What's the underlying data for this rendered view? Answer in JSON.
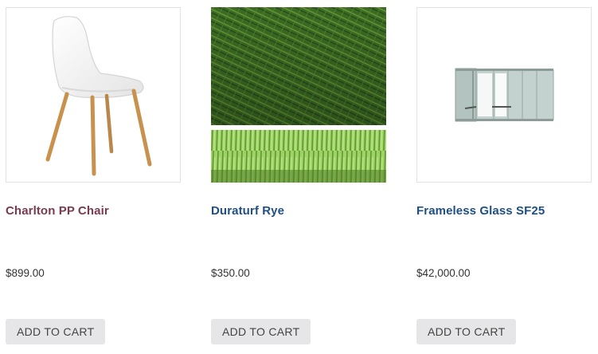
{
  "products": [
    {
      "name": "Charlton PP Chair",
      "price": "$899.00",
      "button_label": "ADD TO CART",
      "image": "white-chair-image"
    },
    {
      "name": "Duraturf Rye",
      "price": "$350.00",
      "button_label": "ADD TO CART",
      "image": "artificial-grass-image"
    },
    {
      "name": "Frameless Glass SF25",
      "price": "$42,000.00",
      "button_label": "ADD TO CART",
      "image": "glass-door-image"
    }
  ],
  "colors": {
    "title_visited": "#7b3a4e",
    "title_link": "#1f4f86",
    "price_text": "#333333",
    "button_bg": "#e6e6e8",
    "grass_dark": "#2f5a1c",
    "grass_light": "#6fa72f",
    "glass_tint": "#b9c8c4"
  }
}
